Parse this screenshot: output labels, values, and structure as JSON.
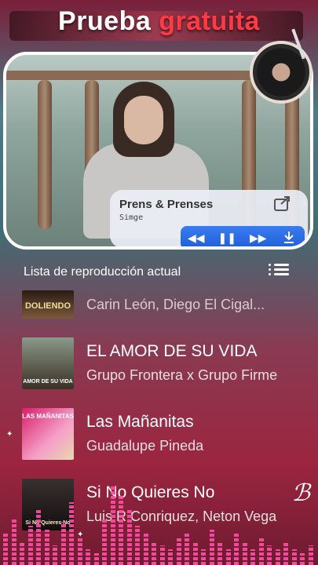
{
  "promo": {
    "word1": "Prueba",
    "word2": "gratuita"
  },
  "now_playing": {
    "title": "Prens & Prenses",
    "artist": "Simge"
  },
  "icons": {
    "share": "share-icon",
    "prev": "previous-icon",
    "pause": "pause-icon",
    "next": "next-icon",
    "download": "download-icon",
    "vinyl": "vinyl-record-icon",
    "list": "playlist-icon"
  },
  "playlist": {
    "header": "Lista de reproducción actual",
    "items": [
      {
        "title": "",
        "artist": "Carin León, Diego El Cigal...",
        "thumb_text": "DOLIENDO"
      },
      {
        "title": "EL AMOR DE SU VIDA",
        "artist": "Grupo Frontera x Grupo Firme",
        "thumb_text": "AMOR DE SU VIDA"
      },
      {
        "title": "Las Mañanitas",
        "artist": "Guadalupe Pineda",
        "thumb_text": "LAS MAÑANITAS"
      },
      {
        "title": "Si No Quieres No",
        "artist": "Luis R Conriquez, Neton Vega",
        "thumb_text": "Si No Quieres No"
      }
    ]
  },
  "colors": {
    "accent": "#ff3a44",
    "control_blue": "#2a6ee6",
    "eq_pink": "#ff4fa5"
  }
}
